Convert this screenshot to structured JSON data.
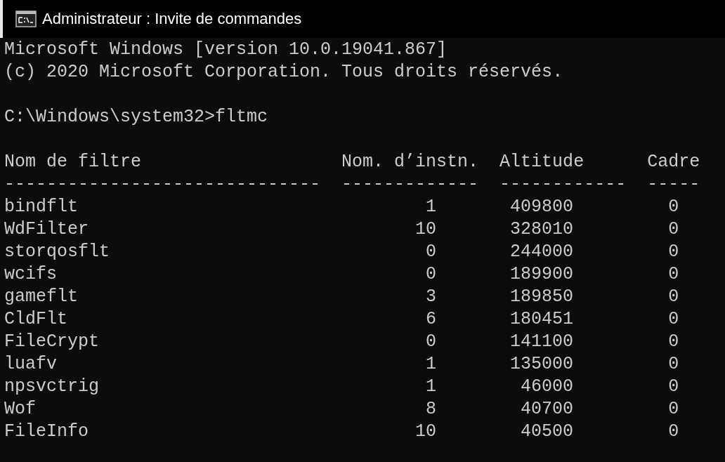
{
  "window": {
    "title": "Administrateur : Invite de commandes"
  },
  "console": {
    "banner": [
      "Microsoft Windows [version 10.0.19041.867]",
      "(c) 2020 Microsoft Corporation. Tous droits réservés."
    ],
    "prompt": "C:\\Windows\\system32>fltmc"
  },
  "table": {
    "columns": [
      {
        "label": "Nom de filtre",
        "rule": "------------------------------"
      },
      {
        "label": "Nom. d’instn.",
        "rule": "-------------"
      },
      {
        "label": "Altitude",
        "rule": "------------"
      },
      {
        "label": "Cadre",
        "rule": "-----"
      }
    ],
    "rows": [
      {
        "name": "bindflt",
        "instances": "1",
        "altitude": "409800",
        "frame": "0"
      },
      {
        "name": "WdFilter",
        "instances": "10",
        "altitude": "328010",
        "frame": "0"
      },
      {
        "name": "storqosflt",
        "instances": "0",
        "altitude": "244000",
        "frame": "0"
      },
      {
        "name": "wcifs",
        "instances": "0",
        "altitude": "189900",
        "frame": "0"
      },
      {
        "name": "gameflt",
        "instances": "3",
        "altitude": "189850",
        "frame": "0"
      },
      {
        "name": "CldFlt",
        "instances": "6",
        "altitude": "180451",
        "frame": "0"
      },
      {
        "name": "FileCrypt",
        "instances": "0",
        "altitude": "141100",
        "frame": "0"
      },
      {
        "name": "luafv",
        "instances": "1",
        "altitude": "135000",
        "frame": "0"
      },
      {
        "name": "npsvctrig",
        "instances": "1",
        "altitude": "46000",
        "frame": "0"
      },
      {
        "name": "Wof",
        "instances": "8",
        "altitude": "40700",
        "frame": "0"
      },
      {
        "name": "FileInfo",
        "instances": "10",
        "altitude": "40500",
        "frame": "0"
      }
    ]
  }
}
